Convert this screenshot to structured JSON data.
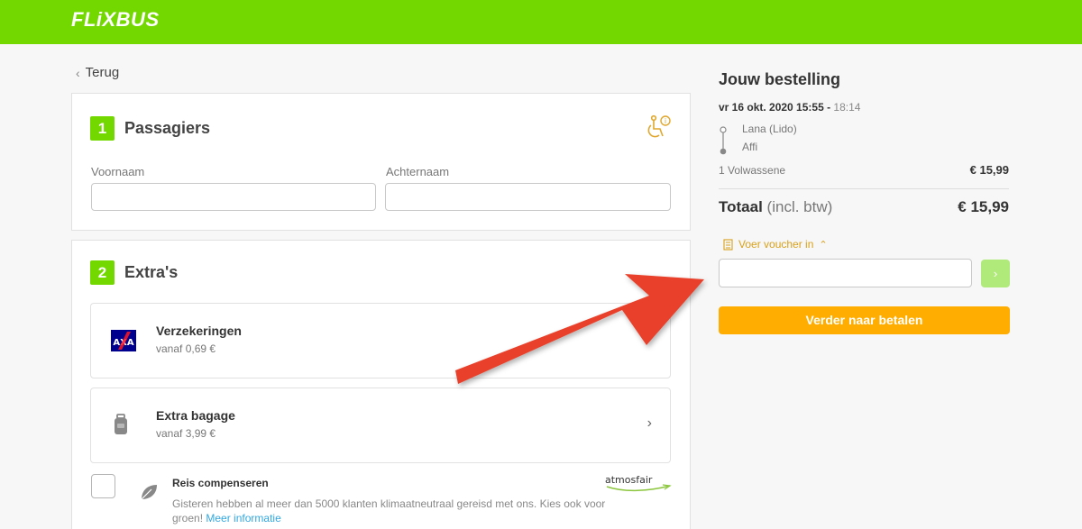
{
  "header": {
    "logo_text": "FLiXBUS",
    "brand_color": "#73d700"
  },
  "back": {
    "label": "Terug",
    "icon": "chevron-left-icon"
  },
  "passengers": {
    "step": "1",
    "title": "Passagiers",
    "accessibility_icon": "wheelchair-info-icon",
    "first_name_label": "Voornaam",
    "last_name_label": "Achternaam",
    "first_name_value": "",
    "last_name_value": ""
  },
  "extras": {
    "step": "2",
    "title": "Extra's",
    "items": [
      {
        "icon": "axa-logo-icon",
        "title": "Verzekeringen",
        "subtitle": "vanaf 0,69 €"
      },
      {
        "icon": "backpack-icon",
        "title": "Extra bagage",
        "subtitle": "vanaf 3,99 €"
      }
    ],
    "compensation": {
      "title": "Reis compenseren",
      "text": "Gisteren hebben al meer dan 5000 klanten klimaatneutraal gereisd met ons. Kies ook voor groen!",
      "link": "Meer informatie",
      "partner": "atmosfair",
      "checked": false
    }
  },
  "order": {
    "title": "Jouw bestelling",
    "date": "vr 16 okt. 2020 15:55",
    "separator": " - ",
    "arrival": "18:14",
    "from": "Lana (Lido)",
    "to": "Affi",
    "pax_label": "1 Volwassene",
    "pax_amount": "€ 15,99",
    "total_label": "Totaal",
    "total_note": "(incl. btw)",
    "total_amount": "€ 15,99",
    "voucher_label": "Voer voucher in",
    "voucher_value": "",
    "voucher_submit": "›",
    "pay_label": "Verder naar betalen",
    "pay_color": "#ffad00"
  },
  "annotation": {
    "arrow_color": "#e8402a"
  }
}
